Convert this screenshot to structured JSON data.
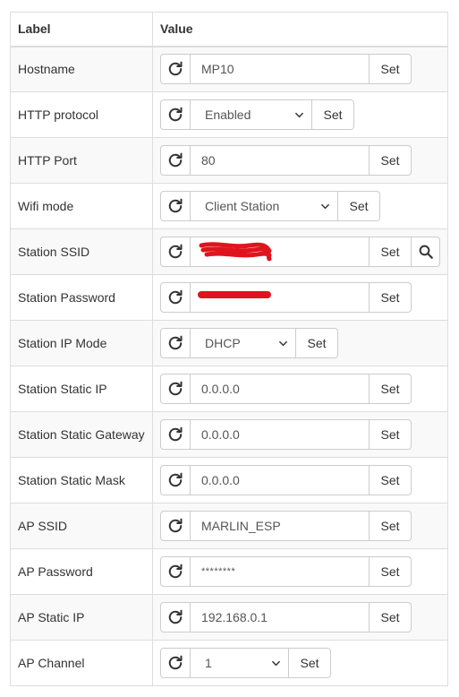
{
  "table": {
    "header": {
      "label": "Label",
      "value": "Value"
    },
    "set_label": "Set",
    "rows": [
      {
        "label": "Hostname",
        "kind": "input",
        "value": "MP10"
      },
      {
        "label": "HTTP protocol",
        "kind": "select",
        "value": "Enabled"
      },
      {
        "label": "HTTP Port",
        "kind": "input",
        "value": "80"
      },
      {
        "label": "Wifi mode",
        "kind": "select",
        "value": "Client Station"
      },
      {
        "label": "Station SSID",
        "kind": "input-search",
        "value": "",
        "redacted": true
      },
      {
        "label": "Station Password",
        "kind": "input",
        "value": "",
        "redacted": true
      },
      {
        "label": "Station IP Mode",
        "kind": "select",
        "value": "DHCP"
      },
      {
        "label": "Station Static IP",
        "kind": "input",
        "value": "0.0.0.0"
      },
      {
        "label": "Station Static Gateway",
        "kind": "input",
        "value": "0.0.0.0"
      },
      {
        "label": "Station Static Mask",
        "kind": "input",
        "value": "0.0.0.0"
      },
      {
        "label": "AP SSID",
        "kind": "input",
        "value": "MARLIN_ESP"
      },
      {
        "label": "AP Password",
        "kind": "input",
        "value": "********"
      },
      {
        "label": "AP Static IP",
        "kind": "input",
        "value": "192.168.0.1"
      },
      {
        "label": "AP Channel",
        "kind": "select",
        "value": "1"
      }
    ]
  },
  "icons": {
    "refresh": "refresh-icon",
    "search": "search-icon",
    "dropdown": "chevron-down-icon"
  },
  "colors": {
    "redaction": "#e0141e",
    "border": "#dddddd",
    "stripe": "#f9f9f9"
  }
}
